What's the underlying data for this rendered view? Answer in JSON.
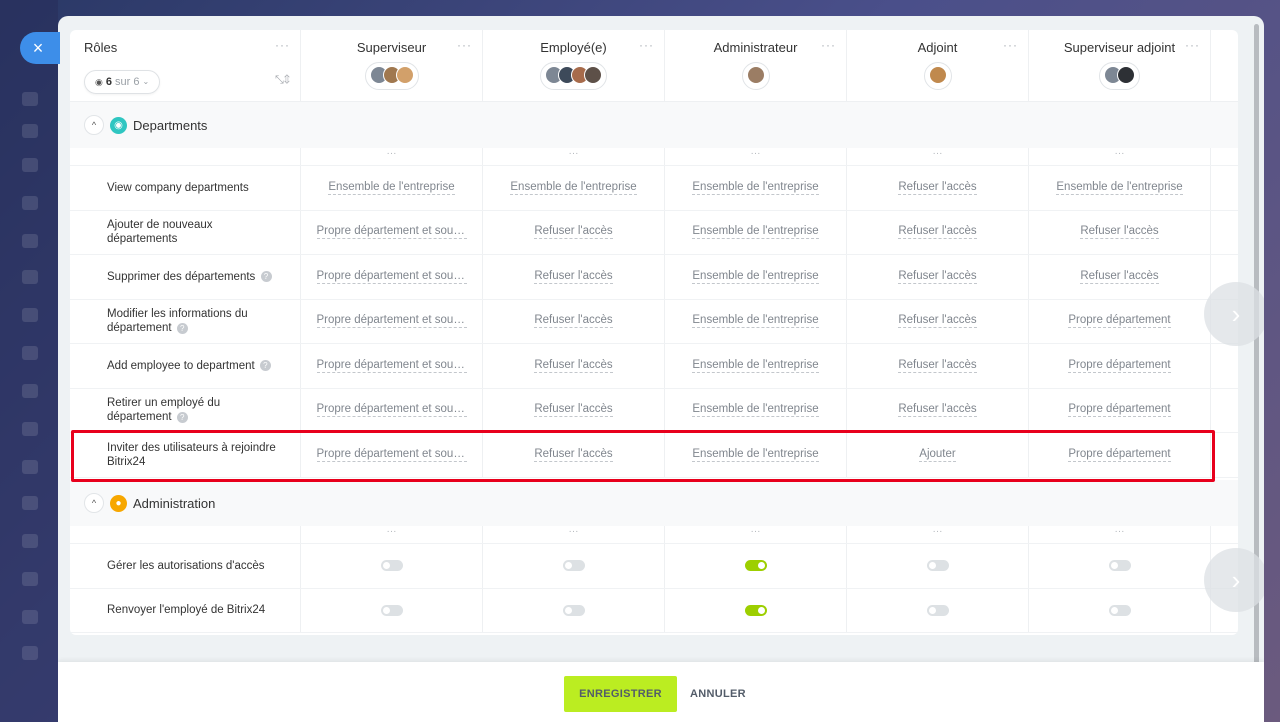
{
  "header": {
    "roles_title": "Rôles",
    "menu_dots": "···",
    "visible_count": "6",
    "visible_total": "sur 6",
    "expand_collapse": "⤡⇕"
  },
  "roles": [
    {
      "name": "Superviseur",
      "avatar_colors": [
        "#7d8794",
        "#a0784f",
        "#d2a06a"
      ]
    },
    {
      "name": "Employé(e)",
      "avatar_colors": [
        "#7d8794",
        "#3d4a5a",
        "#a76b4b",
        "#5d5048"
      ]
    },
    {
      "name": "Administrateur",
      "avatar_colors": [
        "#9b7d64"
      ]
    },
    {
      "name": "Adjoint",
      "avatar_colors": [
        "#c0894d"
      ]
    },
    {
      "name": "Superviseur adjoint",
      "avatar_colors": [
        "#7d8794",
        "#2d3035"
      ]
    }
  ],
  "sections": [
    {
      "title": "Departments",
      "icon": "departments-icon",
      "icon_color": "#2fc6c1",
      "rows": [
        {
          "label": "View company departments",
          "help": false,
          "values": [
            "Ensemble de l'entreprise",
            "Ensemble de l'entreprise",
            "Ensemble de l'entreprise",
            "Refuser l'accès",
            "Ensemble de l'entreprise"
          ]
        },
        {
          "label": "Ajouter de nouveaux départements",
          "help": false,
          "values": [
            "Propre département et sous-départements",
            "Refuser l'accès",
            "Ensemble de l'entreprise",
            "Refuser l'accès",
            "Refuser l'accès"
          ]
        },
        {
          "label": "Supprimer des départements",
          "help": true,
          "values": [
            "Propre département et sous-départements",
            "Refuser l'accès",
            "Ensemble de l'entreprise",
            "Refuser l'accès",
            "Refuser l'accès"
          ]
        },
        {
          "label": "Modifier les informations du département",
          "help": true,
          "values": [
            "Propre département et sous-départements",
            "Refuser l'accès",
            "Ensemble de l'entreprise",
            "Refuser l'accès",
            "Propre département"
          ]
        },
        {
          "label": "Add employee to department",
          "help": true,
          "values": [
            "Propre département et sous-départements",
            "Refuser l'accès",
            "Ensemble de l'entreprise",
            "Refuser l'accès",
            "Propre département"
          ]
        },
        {
          "label": "Retirer un employé du département",
          "help": true,
          "values": [
            "Propre département et sous-départements",
            "Refuser l'accès",
            "Ensemble de l'entreprise",
            "Refuser l'accès",
            "Propre département"
          ]
        },
        {
          "label": "Inviter des utilisateurs à rejoindre Bitrix24",
          "help": false,
          "values": [
            "Propre département et sous-départements",
            "Refuser l'accès",
            "Ensemble de l'entreprise",
            "Ajouter",
            "Propre département"
          ]
        }
      ]
    },
    {
      "title": "Administration",
      "icon": "administration-icon",
      "icon_color": "#f7a700",
      "rows": [
        {
          "label": "Gérer les autorisations d'accès",
          "help": false,
          "toggles": [
            false,
            false,
            true,
            false,
            false
          ]
        },
        {
          "label": "Renvoyer l'employé de Bitrix24",
          "help": false,
          "toggles": [
            false,
            false,
            true,
            false,
            false
          ]
        }
      ]
    }
  ],
  "footer": {
    "save_label": "ENREGISTRER",
    "cancel_label": "ANNULER"
  },
  "icons": {
    "close": "×",
    "eye": "👁",
    "collapse": "^",
    "next": "›",
    "help": "?"
  },
  "colors": {
    "accent_save": "#bbed21",
    "toggle_on": "#9dcf00",
    "highlight": "#e8001c",
    "close_button": "#3d8ee9"
  }
}
